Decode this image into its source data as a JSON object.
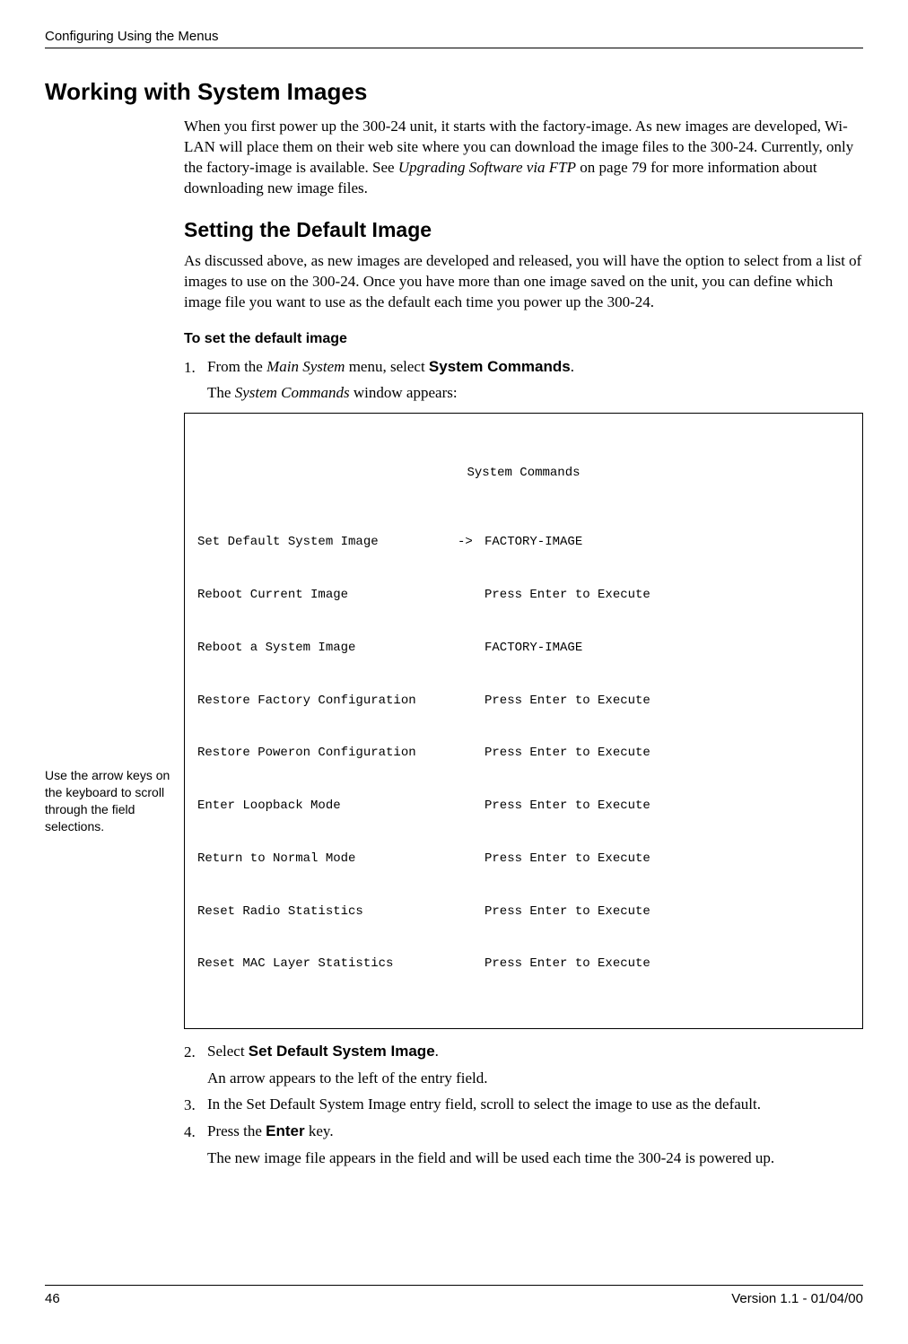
{
  "header": {
    "section_title": "Configuring Using the Menus"
  },
  "h1": "Working with System Images",
  "intro": {
    "text_a": "When you first power up the 300-24 unit, it starts with the factory-image. As new images are developed, Wi-LAN will place them on their web site where you can download the image files to the 300-24. Currently, only the factory-image is available. See ",
    "text_ref": "Upgrading Software via FTP",
    "text_b": " on page 79 for more information about downloading new image files."
  },
  "h2": "Setting the Default Image",
  "subintro": "As discussed above, as new images are developed and released, you will have the option to select from a list of images to use on the 300-24. Once you have more than one image saved on the unit, you can define which image file you want to use as the default each time you power up the 300-24.",
  "h3": "To set the default image",
  "step1": {
    "num": "1.",
    "text_a": "From the ",
    "menu": "Main System",
    "text_b": " menu, select ",
    "select": "System Commands",
    "text_c": ".",
    "sub_a": "The ",
    "sub_i": "System Commands",
    "sub_b": " window appears:"
  },
  "codebox": {
    "title": "System Commands",
    "rows": [
      {
        "left": "Set Default System Image",
        "arrow": "->",
        "right": "FACTORY-IMAGE"
      },
      {
        "left": "Reboot Current Image",
        "arrow": "",
        "right": "Press Enter to Execute"
      },
      {
        "left": "Reboot a System Image",
        "arrow": "",
        "right": "FACTORY-IMAGE"
      },
      {
        "left": "Restore Factory Configuration",
        "arrow": "",
        "right": "Press Enter to Execute"
      },
      {
        "left": "Restore Poweron Configuration",
        "arrow": "",
        "right": "Press Enter to Execute"
      },
      {
        "left": "Enter Loopback Mode",
        "arrow": "",
        "right": "Press Enter to Execute"
      },
      {
        "left": "Return to Normal Mode",
        "arrow": "",
        "right": "Press Enter to Execute"
      },
      {
        "left": "Reset Radio Statistics",
        "arrow": "",
        "right": "Press Enter to Execute"
      },
      {
        "left": "Reset MAC Layer Statistics",
        "arrow": "",
        "right": "Press Enter to Execute"
      }
    ]
  },
  "step2": {
    "num": "2.",
    "text_a": "Select ",
    "select": "Set Default System Image",
    "text_b": ".",
    "sub": "An arrow appears to the left of the entry field."
  },
  "sidenote": "Use the arrow keys on the keyboard to scroll through the field selections.",
  "step3": {
    "num": "3.",
    "text": "In the Set Default System Image entry field, scroll to select the image to use as the default."
  },
  "step4": {
    "num": "4.",
    "text_a": "Press the ",
    "key": "Enter",
    "text_b": " key.",
    "sub": "The new image file appears in the field and will be used each time the 300-24 is powered up."
  },
  "footer": {
    "page": "46",
    "version": "Version 1.1 - 01/04/00"
  }
}
